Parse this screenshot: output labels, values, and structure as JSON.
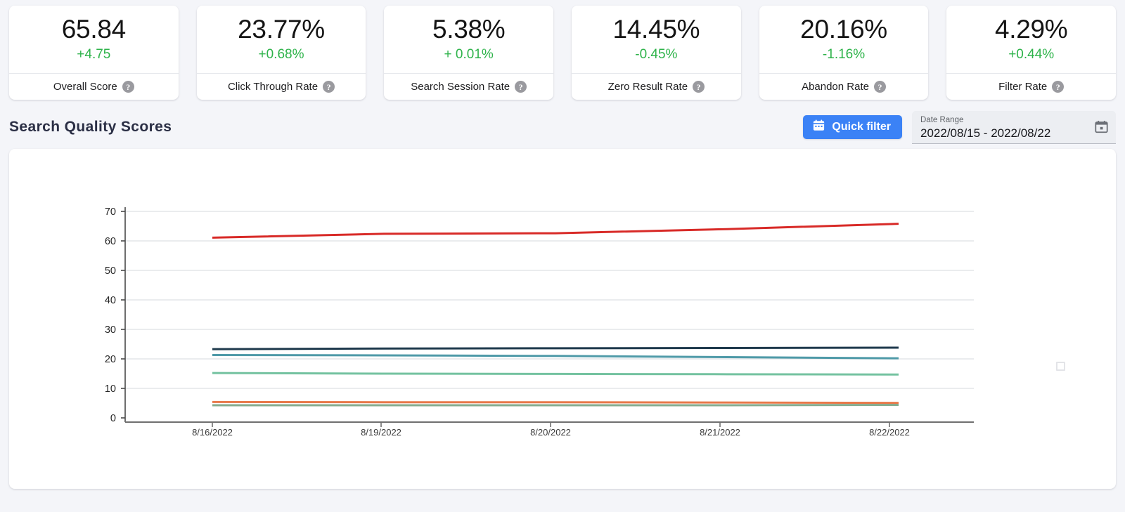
{
  "kpi_cards": [
    {
      "value": "65.84",
      "delta": "+4.75",
      "label": "Overall Score",
      "help": "?"
    },
    {
      "value": "23.77%",
      "delta": "+0.68%",
      "label": "Click Through Rate",
      "help": "?"
    },
    {
      "value": "5.38%",
      "delta": "+ 0.01%",
      "label": "Search Session Rate",
      "help": "?"
    },
    {
      "value": "14.45%",
      "delta": "-0.45%",
      "label": "Zero Result Rate",
      "help": "?"
    },
    {
      "value": "20.16%",
      "delta": "-1.16%",
      "label": "Abandon Rate",
      "help": "?"
    },
    {
      "value": "4.29%",
      "delta": "+0.44%",
      "label": "Filter Rate",
      "help": "?"
    }
  ],
  "section": {
    "title": "Search Quality Scores",
    "quick_filter_label": "Quick filter",
    "date_range_label": "Date Range",
    "date_range_value": "2022/08/15 - 2022/08/22"
  },
  "colors": {
    "accent_blue": "#3b82f6",
    "positive_green": "#2eb34a",
    "title_navy": "#2b2f45",
    "panel_bg": "#ffffff",
    "page_bg": "#f4f5f9"
  },
  "chart_data": {
    "type": "line",
    "title": "",
    "xlabel": "",
    "ylabel": "",
    "ylim": [
      0,
      70
    ],
    "yticks": [
      0,
      10,
      20,
      30,
      40,
      50,
      60,
      70
    ],
    "grid": true,
    "legend": "none",
    "x": [
      "8/16/2022",
      "8/19/2022",
      "8/20/2022",
      "8/21/2022",
      "8/22/2022"
    ],
    "x_positions": [
      0.0,
      0.25,
      0.5,
      0.75,
      1.0
    ],
    "series": [
      {
        "name": "Overall Score",
        "color": "#d82a27",
        "values": [
          61.1,
          62.4,
          62.6,
          64.0,
          65.8
        ]
      },
      {
        "name": "Abandon Rate",
        "color": "#1f3a4d",
        "values": [
          23.3,
          23.5,
          23.6,
          23.7,
          23.8
        ]
      },
      {
        "name": "Click Through Rate",
        "color": "#4f9aa8",
        "values": [
          21.3,
          21.2,
          21.0,
          20.6,
          20.2
        ]
      },
      {
        "name": "Zero Result Rate",
        "color": "#74c2a0",
        "values": [
          15.2,
          15.0,
          14.9,
          14.8,
          14.7
        ]
      },
      {
        "name": "Search Session Rate",
        "color": "#e8794a",
        "values": [
          5.4,
          5.3,
          5.3,
          5.2,
          5.1
        ]
      },
      {
        "name": "Filter Rate",
        "color": "#86ab8e",
        "values": [
          4.3,
          4.3,
          4.3,
          4.3,
          4.4
        ]
      }
    ]
  }
}
